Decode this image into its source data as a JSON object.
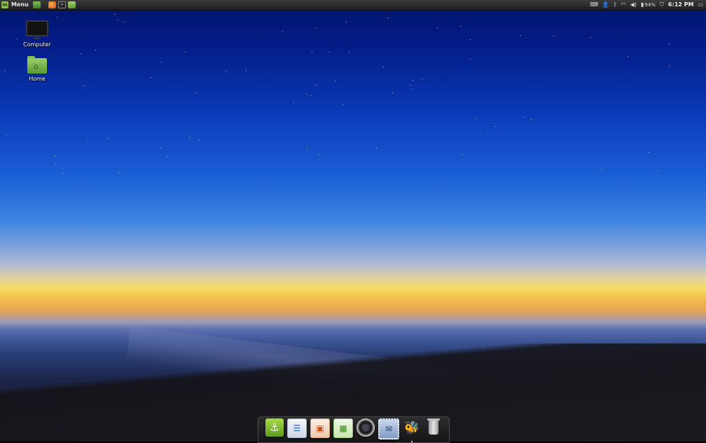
{
  "top_panel": {
    "menu_label": "Menu",
    "launchers": [
      "show-desktop-icon",
      "firefox-icon",
      "terminal-icon",
      "files-icon"
    ],
    "tray": {
      "icons": [
        "keyboard-icon",
        "user-icon",
        "bluetooth-icon",
        "wifi-icon",
        "volume-icon",
        "battery-icon",
        "shield-icon"
      ],
      "battery_percent": "94%",
      "clock": "6:12 PM"
    }
  },
  "desktop": {
    "icons": [
      {
        "label": "Computer",
        "icon": "computer-icon"
      },
      {
        "label": "Home",
        "icon": "home-folder-icon"
      }
    ]
  },
  "dock": {
    "items": [
      "anchor-app-icon",
      "writer-icon",
      "impress-icon",
      "calc-icon",
      "camera-lens-icon",
      "mail-stamp-icon",
      "bee-app-icon",
      "trash-icon"
    ]
  },
  "colors": {
    "panel": "#2a2a2a",
    "sky_top": "#02146a",
    "horizon": "#f6dc62",
    "mint_green": "#8cc152"
  }
}
